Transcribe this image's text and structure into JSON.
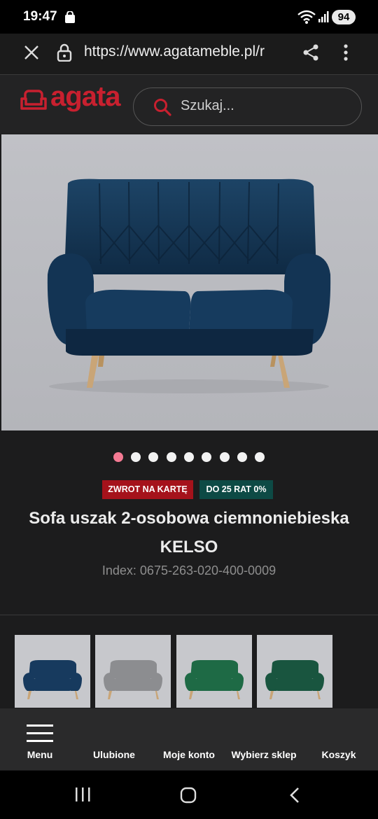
{
  "status_bar": {
    "time": "19:47",
    "battery": "94",
    "icons": [
      "shopping-bag-icon",
      "wifi-icon",
      "signal-icon",
      "battery-icon"
    ]
  },
  "browser": {
    "url": "https://www.agatameble.pl/r",
    "icons": [
      "close-icon",
      "lock-icon",
      "share-icon",
      "more-vert-icon"
    ]
  },
  "site": {
    "logo_text": "agata",
    "search_placeholder": "Szukaj...",
    "brand_color": "#c8202f"
  },
  "gallery": {
    "slide_count": 9,
    "active_index": 0,
    "active_color": "#f47a93"
  },
  "badges": {
    "refund": {
      "label": "ZWROT NA KARTĘ",
      "color": "#a5121b"
    },
    "installments": {
      "label": "DO 25 RAT 0%",
      "color": "#0d4a45"
    }
  },
  "product": {
    "title_line1": "Sofa uszak 2-osobowa ciemnoniebieska",
    "title_line2": "KELSO",
    "index": "Index: 0675-263-020-400-0009"
  },
  "variants": [
    {
      "color": "#173a5e",
      "name": "navy"
    },
    {
      "color": "#8c8d90",
      "name": "grey"
    },
    {
      "color": "#1e6a45",
      "name": "green"
    },
    {
      "color": "#19553f",
      "name": "dark-green"
    }
  ],
  "bottom_nav": {
    "items": [
      {
        "label": "Menu",
        "icon": "hamburger-icon"
      },
      {
        "label": "Ulubione"
      },
      {
        "label": "Moje konto"
      },
      {
        "label": "Wybierz sklep"
      },
      {
        "label": "Koszyk"
      }
    ]
  },
  "system_nav": [
    "recents-icon",
    "home-icon",
    "back-icon"
  ]
}
